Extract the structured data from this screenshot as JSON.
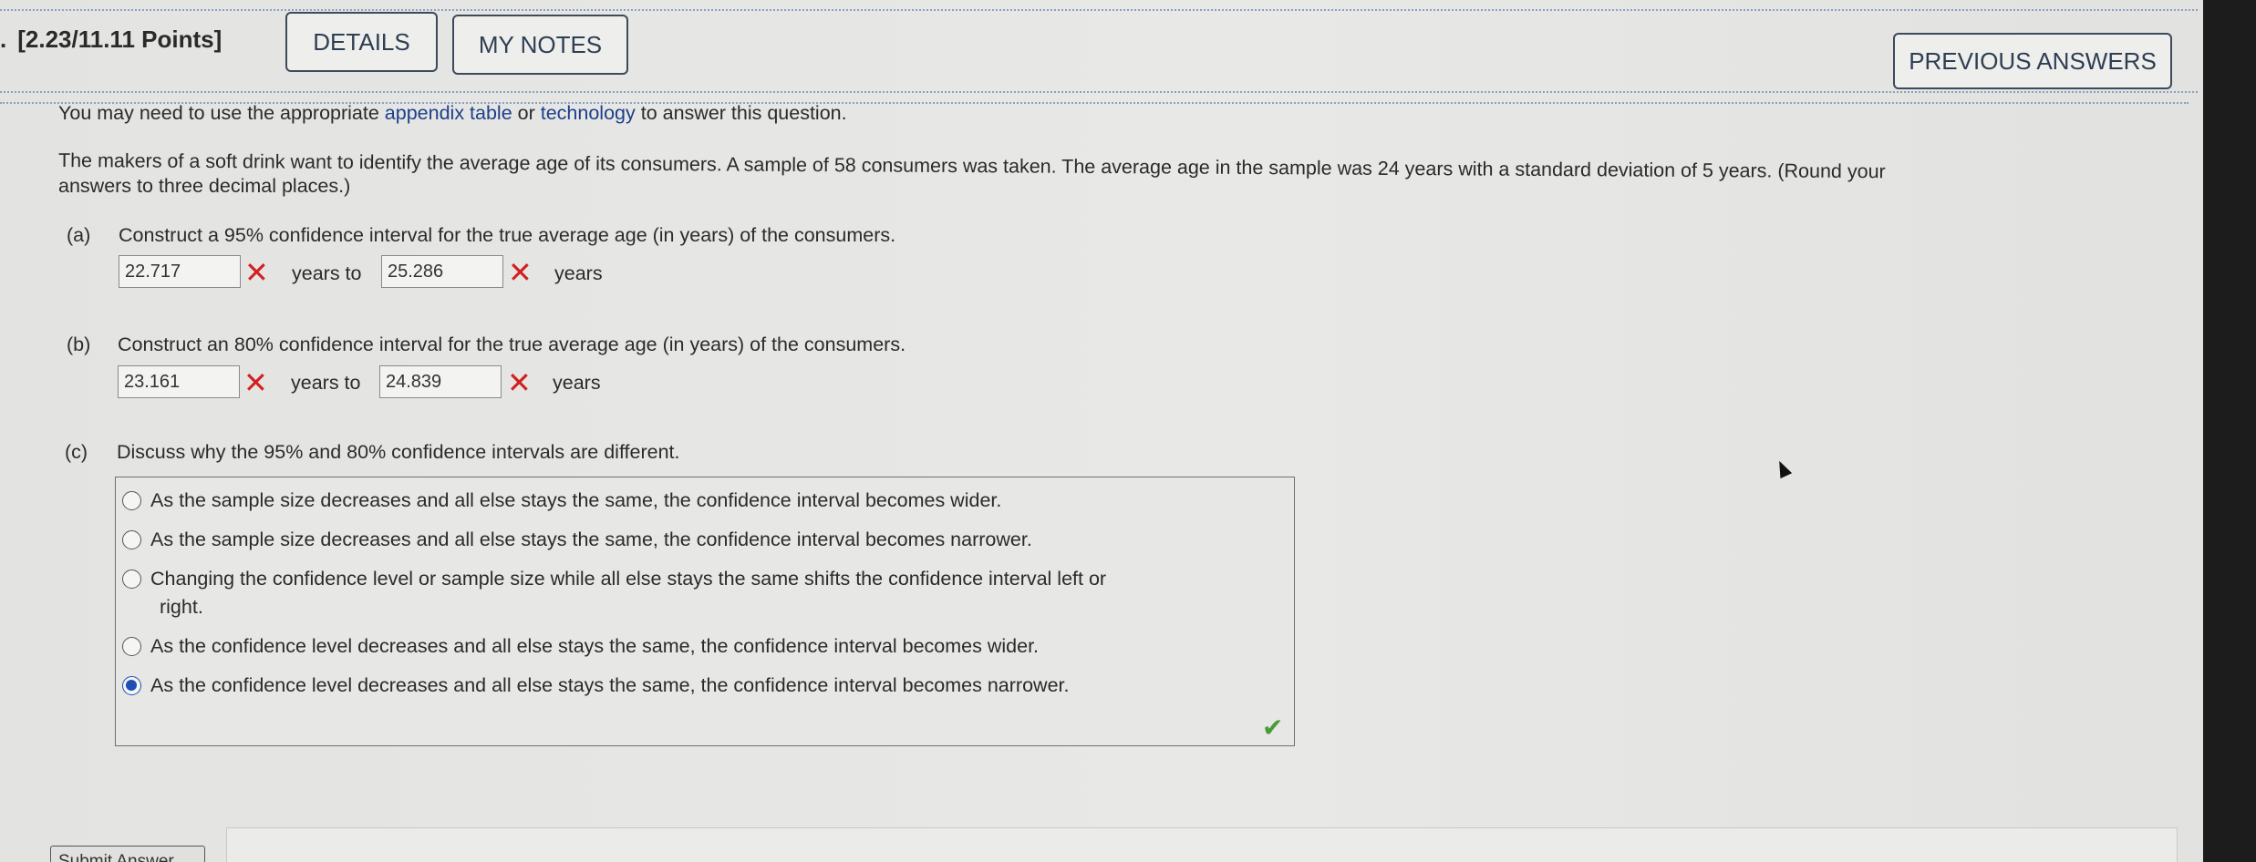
{
  "header": {
    "title": "[2.23/11.11 Points]",
    "details_label": "DETAILS",
    "notes_label": "MY NOTES",
    "previous_label": "PREVIOUS ANSWERS"
  },
  "intro": {
    "before": "You may need to use the appropriate ",
    "link1": "appendix table",
    "middle": " or ",
    "link2": "technology",
    "after": " to answer this question."
  },
  "problem": {
    "line1": "The makers of a soft drink want to identify the average age of its consumers. A sample of 58 consumers was taken. The average age in the sample was 24 years with a standard deviation of 5 years. (Round your",
    "line2": "answers to three decimal places.)"
  },
  "part_a": {
    "label": "(a)",
    "prompt": "Construct a 95% confidence interval for the true average age (in years) of the consumers.",
    "lower_value": "22.717",
    "upper_value": "25.286",
    "years_to": "years to",
    "years": "years"
  },
  "part_b": {
    "label": "(b)",
    "prompt": "Construct an 80% confidence interval for the true average age (in years) of the consumers.",
    "lower_value": "23.161",
    "upper_value": "24.839",
    "years_to": "years to",
    "years": "years"
  },
  "part_c": {
    "label": "(c)",
    "prompt": "Discuss why the 95% and 80% confidence intervals are different.",
    "options": [
      "As the sample size decreases and all else stays the same, the confidence interval becomes wider.",
      "As the sample size decreases and all else stays the same, the confidence interval becomes narrower.",
      "Changing the confidence level or sample size while all else stays the same shifts the confidence interval left or",
      "right.",
      "As the confidence level decreases and all else stays the same, the confidence interval becomes wider.",
      "As the confidence level decreases and all else stays the same, the confidence interval becomes narrower."
    ],
    "selected_index": 4
  },
  "submit": {
    "label": "Submit Answer"
  },
  "icons": {
    "wrong": "x-mark-icon",
    "correct": "check-mark-icon",
    "pointer": "mouse-cursor-icon"
  },
  "colors": {
    "wrong": "#d32020",
    "correct": "#4a9a3a",
    "link": "#1e3f8a",
    "selected_radio": "#1f4fb5"
  }
}
